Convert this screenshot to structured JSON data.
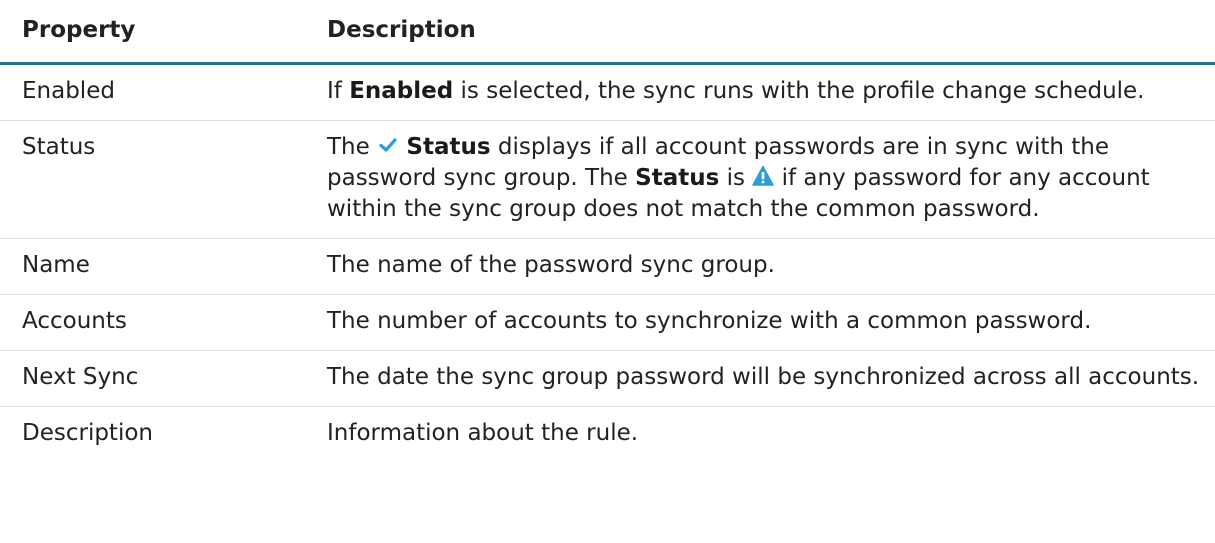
{
  "table": {
    "headers": {
      "property": "Property",
      "description": "Description"
    },
    "rows": [
      {
        "property": "Enabled",
        "desc": {
          "p1": "If ",
          "b1": "Enabled",
          "p2": " is selected, the sync runs with the profile change schedule."
        }
      },
      {
        "property": "Status",
        "desc": {
          "p1": "The ",
          "b1": "Status",
          "p2": " displays if all account passwords are in sync with the password sync group. The ",
          "b2": "Status",
          "p3": " is ",
          "p4": " if any password for any account within the sync group does not match the common password."
        },
        "icons": {
          "in_sync": "checkmark-icon",
          "warning": "warning-triangle-icon"
        },
        "colors": {
          "checkmark": "#2a9fd6",
          "warning": "#2a9fd6"
        }
      },
      {
        "property": "Name",
        "desc": {
          "p1": "The name of the password sync group."
        }
      },
      {
        "property": "Accounts",
        "desc": {
          "p1": "The number of accounts to synchronize with a common password."
        }
      },
      {
        "property": "Next Sync",
        "desc": {
          "p1": "The date the sync group password will be synchronized across all accounts."
        }
      },
      {
        "property": "Description",
        "desc": {
          "p1": "Information about the rule."
        }
      }
    ]
  },
  "colors": {
    "header_rule": "#2c6f8b",
    "row_divider": "#dcdcdc",
    "text": "#222222"
  }
}
